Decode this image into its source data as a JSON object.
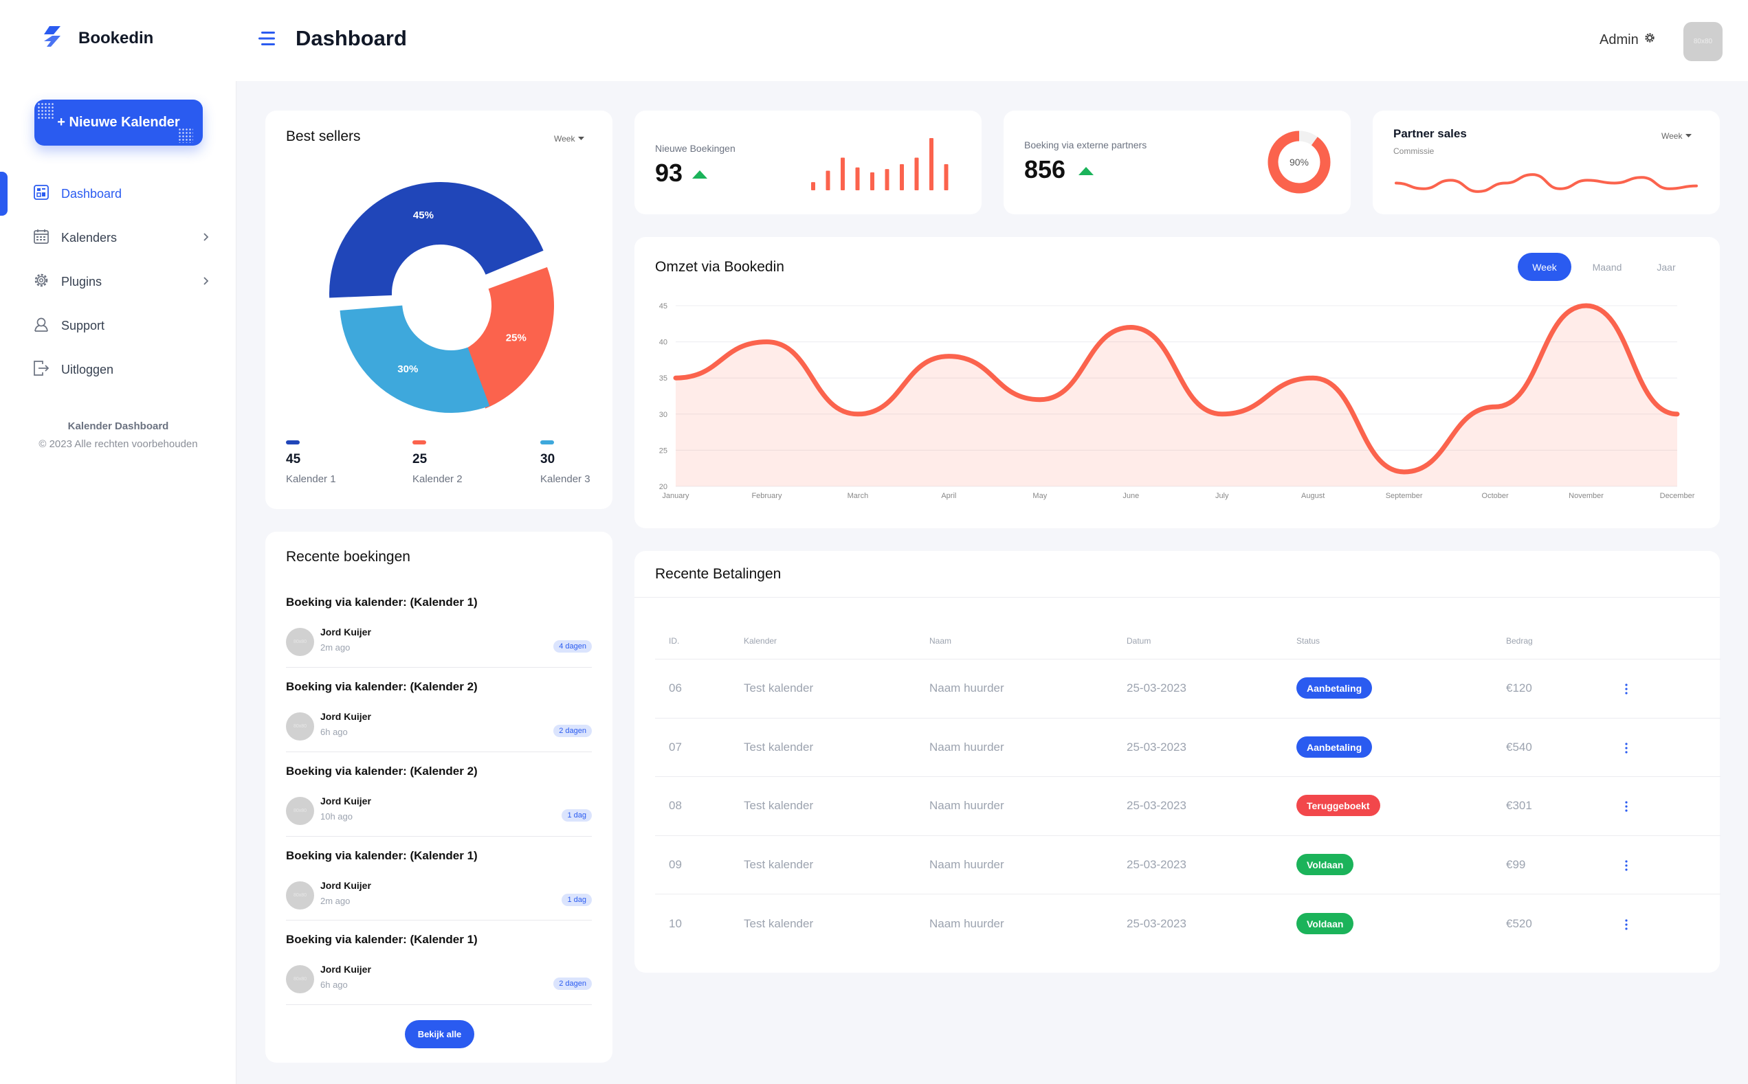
{
  "app": {
    "brand": "Bookedin",
    "page_title": "Dashboard",
    "user_label": "Admin",
    "avatar_text": "80x80"
  },
  "sidebar": {
    "new_button": "+ Nieuwe Kalender",
    "items": [
      {
        "label": "Dashboard",
        "icon": "dashboard-icon",
        "active": true
      },
      {
        "label": "Kalenders",
        "icon": "calendar-icon",
        "has_submenu": true
      },
      {
        "label": "Plugins",
        "icon": "gear-icon",
        "has_submenu": true
      },
      {
        "label": "Support",
        "icon": "support-icon"
      },
      {
        "label": "Uitloggen",
        "icon": "logout-icon"
      }
    ],
    "footer_title": "Kalender Dashboard",
    "footer_copy": "© 2023 Alle rechten voorbehouden"
  },
  "best_sellers": {
    "title": "Best sellers",
    "period": "Week",
    "legend": [
      {
        "value": "45",
        "label": "Kalender 1",
        "color": "#2046b9"
      },
      {
        "value": "25",
        "label": "Kalender 2",
        "color": "#fb634d"
      },
      {
        "value": "30",
        "label": "Kalender 3",
        "color": "#3ea8dc"
      }
    ]
  },
  "recent_bookings": {
    "title": "Recente boekingen",
    "items": [
      {
        "title": "Boeking via kalender: (Kalender 1)",
        "name": "Jord Kuijer",
        "ago": "2m ago",
        "badge": "4 dagen",
        "avatar": "80x80"
      },
      {
        "title": "Boeking via kalender: (Kalender 2)",
        "name": "Jord Kuijer",
        "ago": "6h ago",
        "badge": "2 dagen",
        "avatar": "80x80"
      },
      {
        "title": "Boeking via kalender: (Kalender 2)",
        "name": "Jord Kuijer",
        "ago": "10h ago",
        "badge": "1 dag",
        "avatar": "80x80"
      },
      {
        "title": "Boeking via kalender: (Kalender 1)",
        "name": "Jord Kuijer",
        "ago": "2m ago",
        "badge": "1 dag",
        "avatar": "80x80"
      },
      {
        "title": "Boeking via kalender: (Kalender 1)",
        "name": "Jord Kuijer",
        "ago": "6h ago",
        "badge": "2 dagen",
        "avatar": "80x80"
      }
    ],
    "view_all": "Bekijk alle"
  },
  "stats": {
    "new_bookings": {
      "label": "Nieuwe Boekingen",
      "value": "93",
      "trend": "up"
    },
    "external": {
      "label": "Boeking via externe partners",
      "value": "856",
      "trend": "up",
      "percent_label": "90%"
    },
    "partner_sales": {
      "title": "Partner sales",
      "subtitle": "Commissie",
      "period": "Week"
    }
  },
  "revenue": {
    "title": "Omzet via Bookedin",
    "tabs": [
      "Week",
      "Maand",
      "Jaar"
    ],
    "active_tab": "Week"
  },
  "payments": {
    "title": "Recente Betalingen",
    "columns": [
      "ID.",
      "Kalender",
      "Naam",
      "Datum",
      "Status",
      "Bedrag"
    ],
    "rows": [
      {
        "id": "06",
        "kalender": "Test kalender",
        "naam": "Naam huurder",
        "datum": "25-03-2023",
        "status": "Aanbetaling",
        "status_color": "#2a5bf0",
        "bedrag": "€120"
      },
      {
        "id": "07",
        "kalender": "Test kalender",
        "naam": "Naam huurder",
        "datum": "25-03-2023",
        "status": "Aanbetaling",
        "status_color": "#2a5bf0",
        "bedrag": "€540"
      },
      {
        "id": "08",
        "kalender": "Test kalender",
        "naam": "Naam huurder",
        "datum": "25-03-2023",
        "status": "Teruggeboekt",
        "status_color": "#f2474b",
        "bedrag": "€301"
      },
      {
        "id": "09",
        "kalender": "Test kalender",
        "naam": "Naam huurder",
        "datum": "25-03-2023",
        "status": "Voldaan",
        "status_color": "#1bb35a",
        "bedrag": "€99"
      },
      {
        "id": "10",
        "kalender": "Test kalender",
        "naam": "Naam huurder",
        "datum": "25-03-2023",
        "status": "Voldaan",
        "status_color": "#1bb35a",
        "bedrag": "€520"
      }
    ]
  },
  "colors": {
    "accent": "#2a5bf0",
    "chart_red": "#fb634d",
    "up_green": "#1bb35a"
  },
  "chart_data": [
    {
      "type": "pie",
      "title": "Best sellers",
      "categories": [
        "Kalender 1",
        "Kalender 2",
        "Kalender 3"
      ],
      "values": [
        45,
        25,
        30
      ],
      "labels": [
        "45%",
        "25%",
        "30%"
      ],
      "colors": [
        "#2046b9",
        "#fb634d",
        "#3ea8dc"
      ]
    },
    {
      "type": "bar",
      "title": "",
      "values": [
        5,
        12,
        20,
        14,
        11,
        13,
        16,
        20,
        32,
        16
      ],
      "color": "#fb634d"
    },
    {
      "type": "pie",
      "title": "",
      "values": [
        90,
        10
      ],
      "label": "90%",
      "colors": [
        "#fb634d",
        "#f1f1f1"
      ]
    },
    {
      "type": "line",
      "title": "Partner sales",
      "values": [
        4,
        2,
        5,
        1,
        4,
        7,
        2,
        5,
        4,
        6,
        2,
        3
      ],
      "color": "#fb634d"
    },
    {
      "type": "area",
      "title": "Omzet via Bookedin",
      "categories": [
        "January",
        "February",
        "March",
        "April",
        "May",
        "June",
        "July",
        "August",
        "September",
        "October",
        "November",
        "December"
      ],
      "values": [
        35,
        40,
        30,
        38,
        32,
        42,
        30,
        35,
        22,
        31,
        45,
        30
      ],
      "ylim": [
        20,
        45
      ],
      "yticks": [
        20,
        25,
        30,
        35,
        40,
        45
      ],
      "grid": true,
      "color": "#fb634d"
    }
  ]
}
